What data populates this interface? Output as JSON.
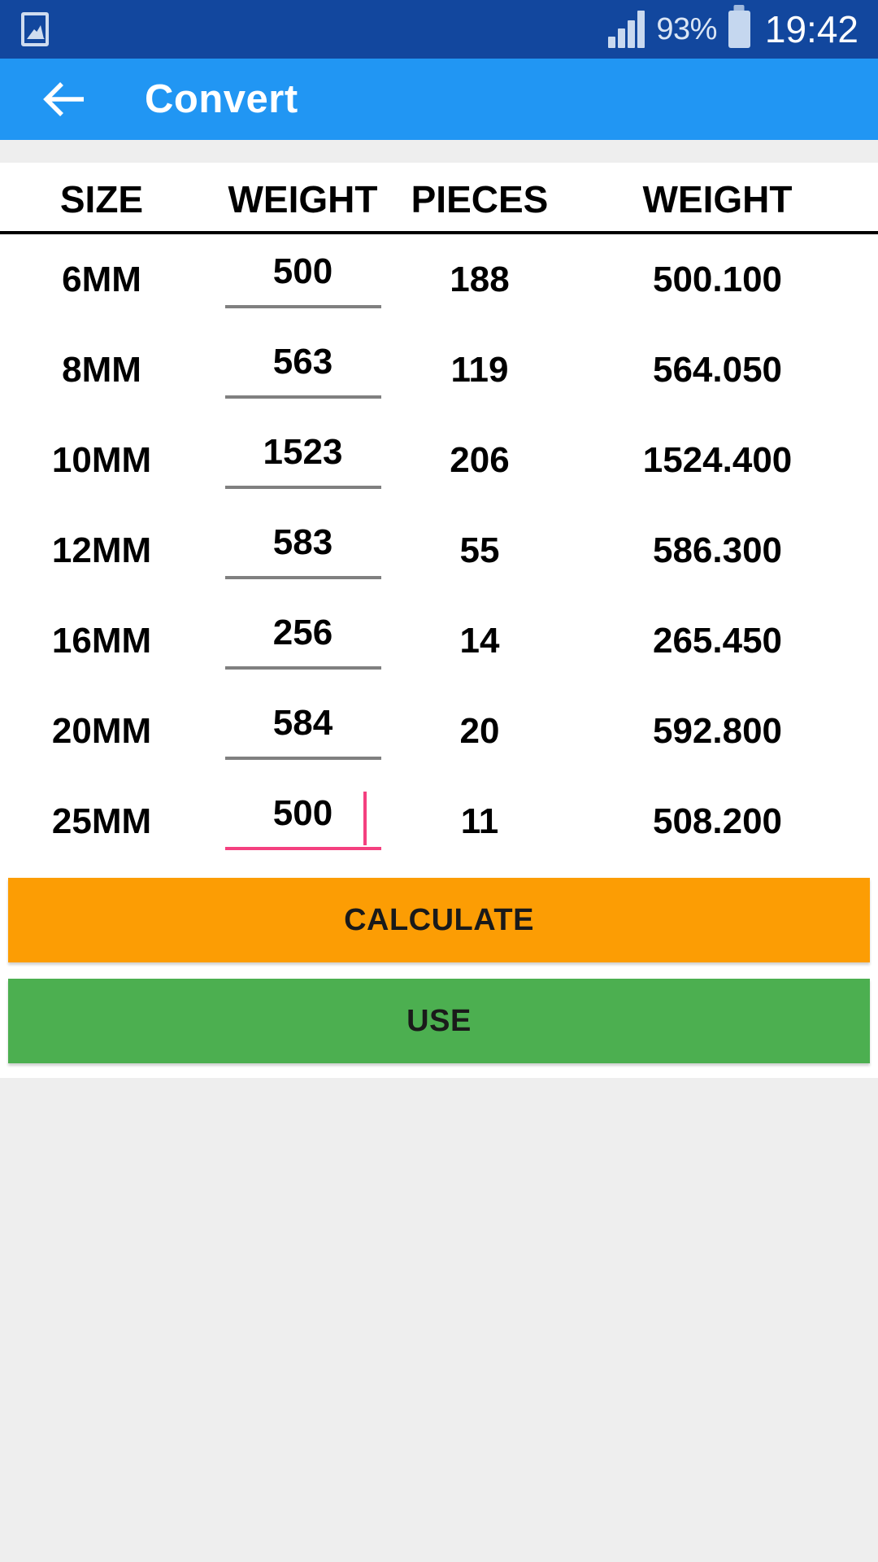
{
  "status_bar": {
    "notification_icon": "gallery-image-icon",
    "battery_percent": "93%",
    "time": "19:42",
    "background_color": "#12479E",
    "signal_bars": 4
  },
  "app_bar": {
    "back_icon": "arrow-left-icon",
    "title": "Convert",
    "background_color": "#2196F3"
  },
  "table": {
    "headers": [
      "SIZE",
      "WEIGHT",
      "PIECES",
      "WEIGHT"
    ],
    "rows": [
      {
        "size": "6MM",
        "weight_input": "500",
        "pieces": "188",
        "weight_result": "500.100",
        "focused": false
      },
      {
        "size": "8MM",
        "weight_input": "563",
        "pieces": "119",
        "weight_result": "564.050",
        "focused": false
      },
      {
        "size": "10MM",
        "weight_input": "1523",
        "pieces": "206",
        "weight_result": "1524.400",
        "focused": false
      },
      {
        "size": "12MM",
        "weight_input": "583",
        "pieces": "55",
        "weight_result": "586.300",
        "focused": false
      },
      {
        "size": "16MM",
        "weight_input": "256",
        "pieces": "14",
        "weight_result": "265.450",
        "focused": false
      },
      {
        "size": "20MM",
        "weight_input": "584",
        "pieces": "20",
        "weight_result": "592.800",
        "focused": false
      },
      {
        "size": "25MM",
        "weight_input": "500",
        "pieces": "11",
        "weight_result": "508.200",
        "focused": true
      }
    ]
  },
  "buttons": {
    "calculate_label": "CALCULATE",
    "calculate_color": "#FC9D04",
    "use_label": "USE",
    "use_color": "#4CAF50"
  }
}
